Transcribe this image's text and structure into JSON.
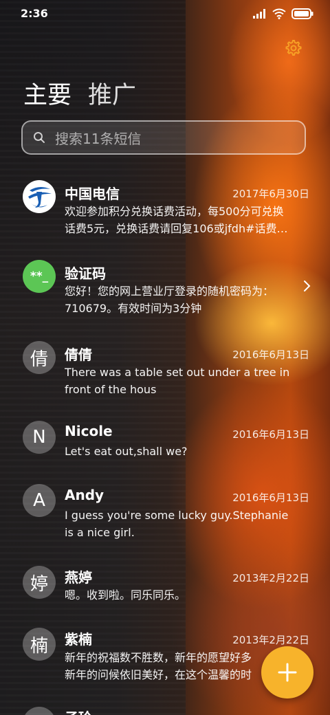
{
  "status_bar": {
    "time": "2:36",
    "icons": [
      "signal-icon",
      "wifi-icon",
      "battery-icon"
    ]
  },
  "header": {
    "settings_icon": "gear-icon",
    "tabs": [
      {
        "label": "主要",
        "selected": true
      },
      {
        "label": "推广",
        "selected": false
      }
    ]
  },
  "search": {
    "placeholder": "搜索11条短信",
    "icon": "search-icon"
  },
  "conversations": [
    {
      "name": "中国电信",
      "date": "2017年6月30日",
      "avatar": "china-telecom-logo",
      "preview": [
        "欢迎参加积分兑换话费活动，每500分可兑换",
        "话费5元，兑换话费请回复106或jfdh#话费…"
      ]
    },
    {
      "name": "验证码",
      "date": "",
      "avatar_text": "**_",
      "avatar_color": "#5cc655",
      "preview": [
        "您好！您的网上营业厅登录的随机密码为：",
        "710679。有效时间为3分钟"
      ],
      "chevron": "chevron-right-icon"
    },
    {
      "name": "倩倩",
      "date": "2016年6月13日",
      "avatar_text": "倩",
      "preview": [
        "There was a table set out under a tree in",
        "front of the hous"
      ]
    },
    {
      "name": "Nicole",
      "date": "2016年6月13日",
      "avatar_text": "N",
      "preview": [
        "Let's eat out,shall we?"
      ]
    },
    {
      "name": "Andy",
      "date": "2016年6月13日",
      "avatar_text": "A",
      "preview": [
        "I guess you're some lucky guy.Stephanie",
        "is a nice girl."
      ]
    },
    {
      "name": "燕婷",
      "date": "2013年2月22日",
      "avatar_text": "婷",
      "preview": [
        "嗯。收到啦。同乐同乐。"
      ]
    },
    {
      "name": "紫楠",
      "date": "2013年2月22日",
      "avatar_text": "楠",
      "preview": [
        "新年的祝福数不胜数，新年的愿望好多",
        "新年的问候依旧美好，在这个温馨的时"
      ]
    },
    {
      "name": "子玲",
      "date": "",
      "avatar_text": "",
      "preview": []
    }
  ],
  "fab": {
    "icon": "plus-icon",
    "color": "#f7b32b"
  },
  "colors": {
    "accent": "#f7b32b",
    "verification_avatar": "#5cc655",
    "telecom_blue": "#1a5fb4"
  }
}
